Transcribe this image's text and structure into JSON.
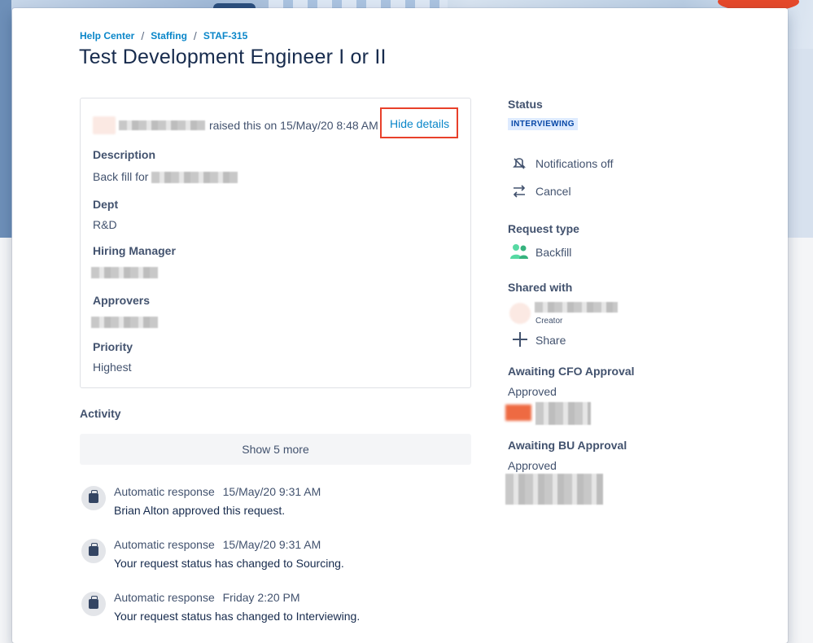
{
  "breadcrumb": {
    "help_center": "Help Center",
    "staffing": "Staffing",
    "ticket": "STAF-315"
  },
  "title": "Test Development Engineer I or II",
  "request": {
    "raised_text": "raised this on 15/May/20 8:48 AM",
    "hide_details": "Hide details",
    "description_label": "Description",
    "description_value": "Back fill for",
    "dept_label": "Dept",
    "dept_value": "R&D",
    "hiring_manager_label": "Hiring Manager",
    "approvers_label": "Approvers",
    "priority_label": "Priority",
    "priority_value": "Highest"
  },
  "activity": {
    "label": "Activity",
    "show_more": "Show 5 more",
    "items": [
      {
        "who": "Automatic response",
        "when": "15/May/20 9:31 AM",
        "text": "Brian Alton approved this request."
      },
      {
        "who": "Automatic response",
        "when": "15/May/20 9:31 AM",
        "text": "Your request status has changed to Sourcing."
      },
      {
        "who": "Automatic response",
        "when": "Friday 2:20 PM",
        "text": "Your request status has changed to Interviewing."
      }
    ]
  },
  "sidebar": {
    "status_label": "Status",
    "status_value": "INTERVIEWING",
    "notifications": "Notifications off",
    "cancel": "Cancel",
    "request_type_label": "Request type",
    "request_type_value": "Backfill",
    "shared_with_label": "Shared with",
    "creator_label": "Creator",
    "share": "Share",
    "cfo_label": "Awaiting CFO Approval",
    "cfo_value": "Approved",
    "bu_label": "Awaiting BU Approval",
    "bu_value": "Approved"
  },
  "colors": {
    "link": "#0a86c9",
    "highlight_border": "#e8402a",
    "status_bg": "#deebff",
    "status_text": "#0747a6"
  }
}
